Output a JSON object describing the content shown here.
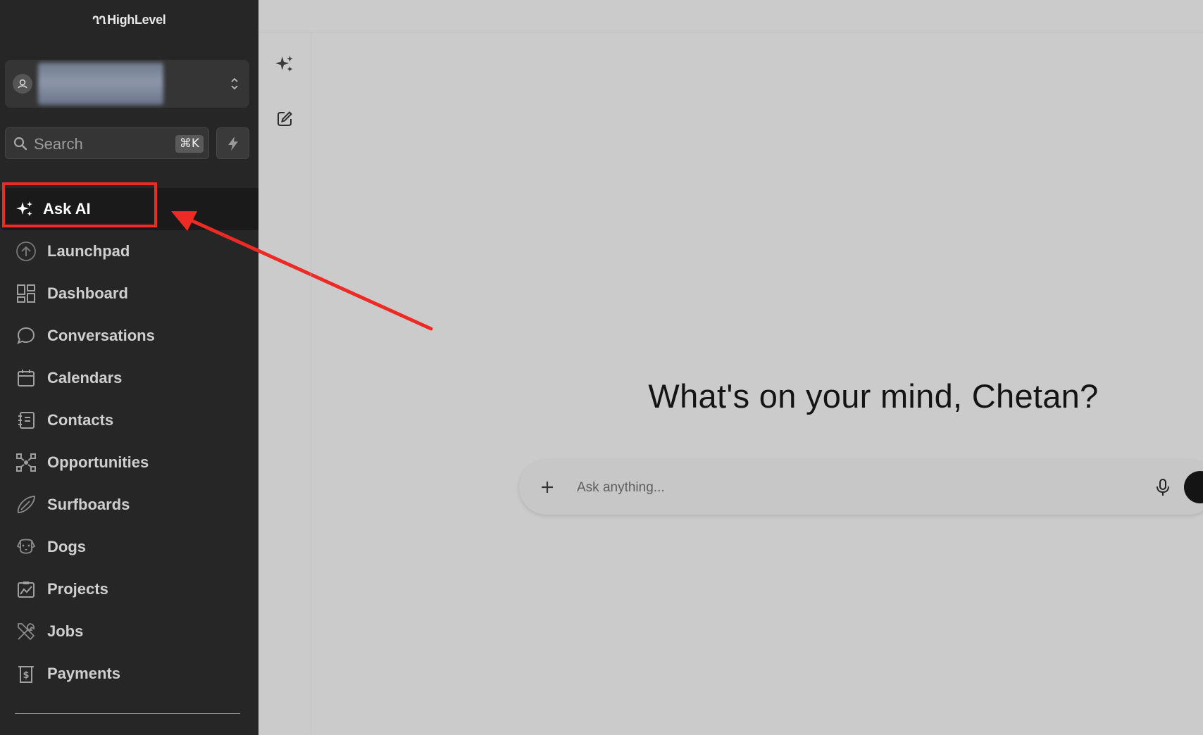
{
  "brand": {
    "mark": "ՂՂ",
    "name": "HighLevel"
  },
  "sidebar": {
    "search_placeholder": "Search",
    "search_shortcut": "⌘K",
    "items": [
      {
        "label": "Ask AI",
        "icon": "sparkle-icon",
        "active": true
      },
      {
        "label": "Launchpad",
        "icon": "launchpad-icon"
      },
      {
        "label": "Dashboard",
        "icon": "dashboard-grid-icon"
      },
      {
        "label": "Conversations",
        "icon": "chat-bubble-icon"
      },
      {
        "label": "Calendars",
        "icon": "calendar-icon"
      },
      {
        "label": "Contacts",
        "icon": "contacts-book-icon"
      },
      {
        "label": "Opportunities",
        "icon": "opportunities-network-icon"
      },
      {
        "label": "Surfboards",
        "icon": "surfboard-icon"
      },
      {
        "label": "Dogs",
        "icon": "dog-face-icon"
      },
      {
        "label": "Projects",
        "icon": "projects-chart-icon"
      },
      {
        "label": "Jobs",
        "icon": "tools-icon"
      },
      {
        "label": "Payments",
        "icon": "payments-receipt-icon"
      }
    ]
  },
  "main": {
    "greeting": "What's on your mind, Chetan?",
    "ask_placeholder": "Ask anything..."
  },
  "colors": {
    "annotation": "#ee2a24",
    "sidebar_bg": "#262626",
    "content_bg": "#cbcbcb"
  }
}
